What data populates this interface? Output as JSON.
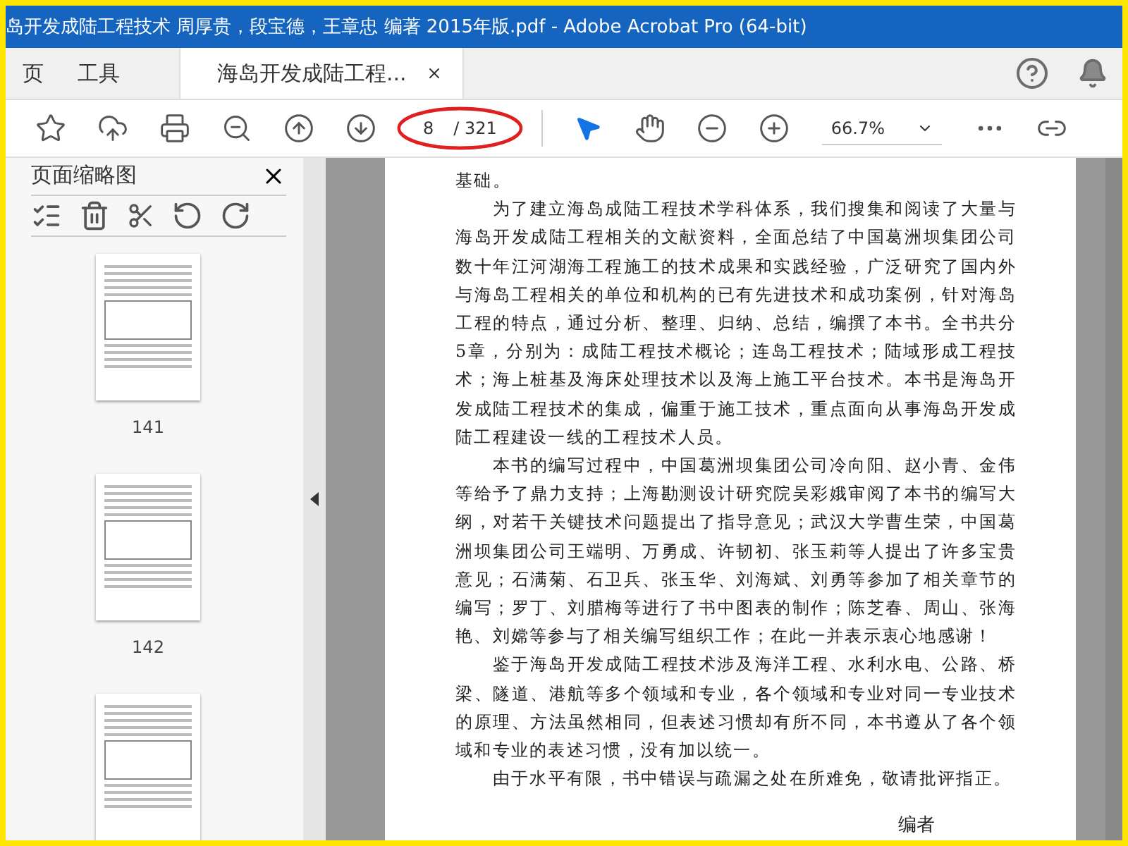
{
  "window": {
    "title": "岛开发成陆工程技术 周厚贵，段宝德，王章忠 编著 2015年版.pdf - Adobe Acrobat Pro (64-bit)"
  },
  "tabs": [
    {
      "label": "页",
      "kind": "nav",
      "selected": false
    },
    {
      "label": "工具",
      "kind": "nav",
      "selected": false
    },
    {
      "label": "海岛开发成陆工程...",
      "kind": "document",
      "selected": true
    }
  ],
  "toolbar": {
    "tools": [
      {
        "kind": "select",
        "selected": true
      },
      {
        "kind": "hand",
        "selected": false
      }
    ],
    "page_number": "8",
    "page_total": "/ 321",
    "zoom": "66.7%",
    "page_number_circled": true
  },
  "sidebar": {
    "title": "页面缩略图",
    "thumbnails": [
      {
        "kind": "page",
        "label": "141"
      },
      {
        "kind": "page",
        "label": "142"
      },
      {
        "kind": "page"
      }
    ]
  },
  "document": {
    "paragraphs": [
      {
        "indent": false,
        "text": "基础。"
      },
      {
        "indent": true,
        "text": "为了建立海岛成陆工程技术学科体系，我们搜集和阅读了大量与海岛开发成陆工程相关的文献资料，全面总结了中国葛洲坝集团公司数十年江河湖海工程施工的技术成果和实践经验，广泛研究了国内外与海岛工程相关的单位和机构的已有先进技术和成功案例，针对海岛工程的特点，通过分析、整理、归纳、总结，编撰了本书。全书共分5章，分别为：成陆工程技术概论；连岛工程技术；陆域形成工程技术；海上桩基及海床处理技术以及海上施工平台技术。本书是海岛开发成陆工程技术的集成，偏重于施工技术，重点面向从事海岛开发成陆工程建设一线的工程技术人员。"
      },
      {
        "indent": true,
        "text": "本书的编写过程中，中国葛洲坝集团公司冷向阳、赵小青、金伟等给予了鼎力支持；上海勘测设计研究院吴彩娥审阅了本书的编写大纲，对若干关键技术问题提出了指导意见；武汉大学曹生荣，中国葛洲坝集团公司王端明、万勇成、许韧初、张玉莉等人提出了许多宝贵意见；石满菊、石卫兵、张玉华、刘海斌、刘勇等参加了相关章节的编写；罗丁、刘腊梅等进行了书中图表的制作；陈芝春、周山、张海艳、刘嫦等参与了相关编写组织工作；在此一并表示衷心地感谢！"
      },
      {
        "indent": true,
        "text": "鉴于海岛开发成陆工程技术涉及海洋工程、水利水电、公路、桥梁、隧道、港航等多个领域和专业，各个领域和专业对同一专业技术的原理、方法虽然相同，但表述习惯却有所不同，本书遵从了各个领域和专业的表述习惯，没有加以统一。"
      },
      {
        "indent": true,
        "text": "由于水平有限，书中错误与疏漏之处在所难免，敬请批评指正。"
      }
    ],
    "signature": "编者"
  }
}
